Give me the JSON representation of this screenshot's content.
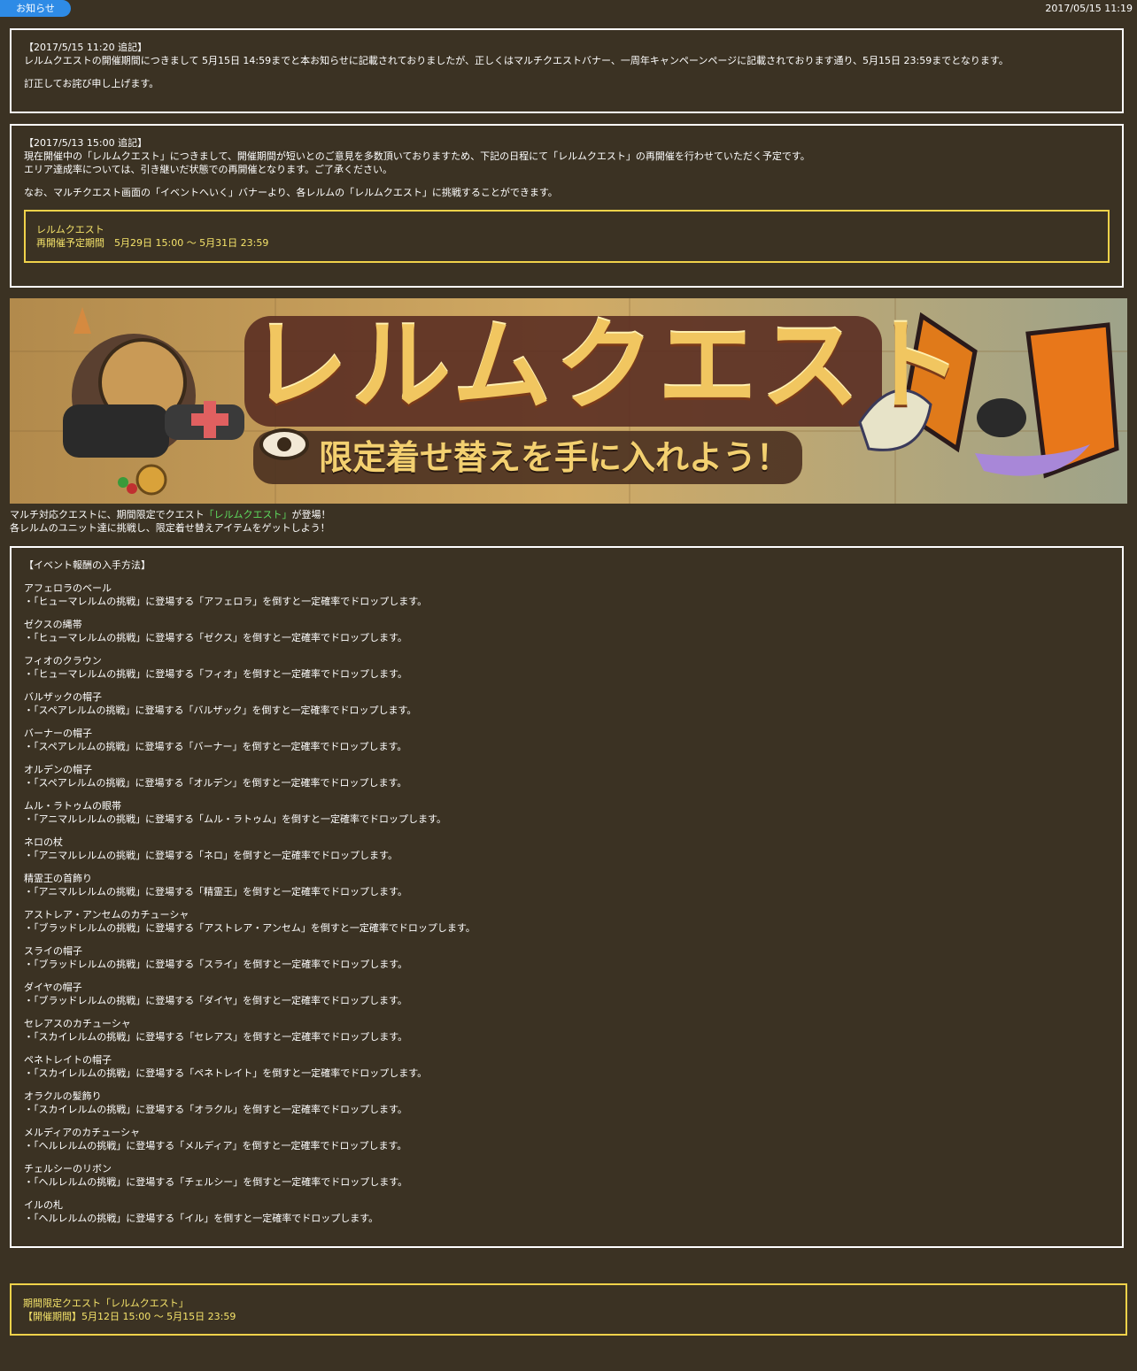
{
  "header": {
    "tag_label": "お知らせ",
    "date": "2017/05/15 11:19"
  },
  "notice1": {
    "heading": "【2017/5/15 11:20 追記】",
    "line1": "レルムクエストの開催期間につきまして 5月15日 14:59までと本お知らせに記載されておりましたが、正しくはマルチクエストバナー、一周年キャンペーンページに記載されております通り、5月15日 23:59までとなります。",
    "line2": "訂正してお詫び申し上げます。"
  },
  "notice2": {
    "heading": "【2017/5/13 15:00 追記】",
    "line1": "現在開催中の「レルムクエスト」につきまして、開催期間が短いとのご意見を多数頂いておりますため、下記の日程にて「レルムクエスト」の再開催を行わせていただく予定です。",
    "line2": "エリア達成率については、引き継いだ状態での再開催となります。ご了承ください。",
    "line3": "なお、マルチクエスト画面の「イベントへいく」バナーより、各レルムの「レルムクエスト」に挑戦することができます。",
    "highlight_title": "レルムクエスト",
    "highlight_period": "再開催予定期間　5月29日 15:00 ～ 5月31日 23:59"
  },
  "banner": {
    "title": "レルムクエスト",
    "subtitle": "限定着せ替えを手に入れよう！"
  },
  "intro": {
    "line1_pre": "マルチ対応クエストに、期間限定でクエスト",
    "line1_link": "「レルムクエスト」",
    "line1_post": "が登場！",
    "line2": "各レルムのユニット達に挑戦し、限定着せ替えアイテムをゲットしよう！"
  },
  "rewards": {
    "heading": "【イベント報酬の入手方法】",
    "items": [
      {
        "name": "アフェロラのベール",
        "desc": "・「ヒューマレルムの挑戦」に登場する「アフェロラ」を倒すと一定確率でドロップします。"
      },
      {
        "name": "ゼクスの縄帯",
        "desc": "・「ヒューマレルムの挑戦」に登場する「ゼクス」を倒すと一定確率でドロップします。"
      },
      {
        "name": "フィオのクラウン",
        "desc": "・「ヒューマレルムの挑戦」に登場する「フィオ」を倒すと一定確率でドロップします。"
      },
      {
        "name": "バルザックの帽子",
        "desc": "・「スペアレルムの挑戦」に登場する「バルザック」を倒すと一定確率でドロップします。"
      },
      {
        "name": "バーナーの帽子",
        "desc": "・「スペアレルムの挑戦」に登場する「バーナー」を倒すと一定確率でドロップします。"
      },
      {
        "name": "オルデンの帽子",
        "desc": "・「スペアレルムの挑戦」に登場する「オルデン」を倒すと一定確率でドロップします。"
      },
      {
        "name": "ムル・ラトゥムの眼帯",
        "desc": "・「アニマルレルムの挑戦」に登場する「ムル・ラトゥム」を倒すと一定確率でドロップします。"
      },
      {
        "name": "ネロの杖",
        "desc": "・「アニマルレルムの挑戦」に登場する「ネロ」を倒すと一定確率でドロップします。"
      },
      {
        "name": "精霊王の首飾り",
        "desc": "・「アニマルレルムの挑戦」に登場する「精霊王」を倒すと一定確率でドロップします。"
      },
      {
        "name": "アストレア・アンセムのカチューシャ",
        "desc": "・「ブラッドレルムの挑戦」に登場する「アストレア・アンセム」を倒すと一定確率でドロップします。"
      },
      {
        "name": "スライの帽子",
        "desc": "・「ブラッドレルムの挑戦」に登場する「スライ」を倒すと一定確率でドロップします。"
      },
      {
        "name": "ダイヤの帽子",
        "desc": "・「ブラッドレルムの挑戦」に登場する「ダイヤ」を倒すと一定確率でドロップします。"
      },
      {
        "name": "セレアスのカチューシャ",
        "desc": "・「スカイレルムの挑戦」に登場する「セレアス」を倒すと一定確率でドロップします。"
      },
      {
        "name": "ペネトレイトの帽子",
        "desc": "・「スカイレルムの挑戦」に登場する「ペネトレイト」を倒すと一定確率でドロップします。"
      },
      {
        "name": "オラクルの髪飾り",
        "desc": "・「スカイレルムの挑戦」に登場する「オラクル」を倒すと一定確率でドロップします。"
      },
      {
        "name": "メルディアのカチューシャ",
        "desc": "・「ヘルレルムの挑戦」に登場する「メルディア」を倒すと一定確率でドロップします。"
      },
      {
        "name": "チェルシーのリボン",
        "desc": "・「ヘルレルムの挑戦」に登場する「チェルシー」を倒すと一定確率でドロップします。"
      },
      {
        "name": "イルの札",
        "desc": "・「ヘルレルムの挑戦」に登場する「イル」を倒すと一定確率でドロップします。"
      }
    ]
  },
  "period": {
    "line1": "期間限定クエスト「レルムクエスト」",
    "line2": "【開催期間】5月12日 15:00 ～ 5月15日 23:59"
  },
  "colors": {
    "background": "#3b3223",
    "tag": "#2e8be6",
    "highlight": "#f0d24a",
    "link_green": "#5fdc5f"
  }
}
